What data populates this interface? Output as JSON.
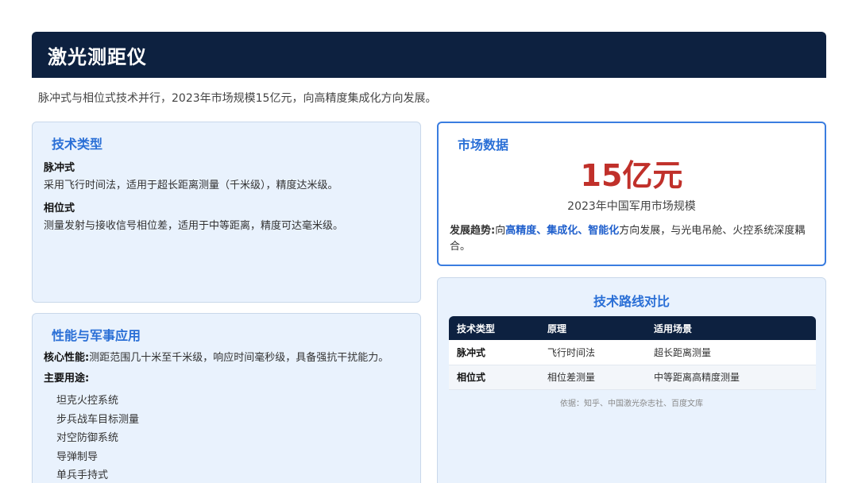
{
  "header": {
    "title": "激光测距仪"
  },
  "subtitle": "脉冲式与相位式技术并行，2023年市场规模15亿元，向高精度集成化方向发展。",
  "tech_types": {
    "title": "技术类型",
    "items": [
      {
        "name": "脉冲式",
        "desc": "采用飞行时间法，适用于超长距离测量（千米级），精度达米级。"
      },
      {
        "name": "相位式",
        "desc": "测量发射与接收信号相位差，适用于中等距离，精度可达毫米级。"
      }
    ]
  },
  "performance": {
    "title": "性能与军事应用",
    "core_label": "核心性能:",
    "core_text": "测距范围几十米至千米级，响应时间毫秒级，具备强抗干扰能力。",
    "uses_label": "主要用途:",
    "uses": [
      "坦克火控系统",
      "步兵战车目标测量",
      "对空防御系统",
      "导弹制导",
      "单兵手持式"
    ]
  },
  "market": {
    "title": "市场数据",
    "value": "15亿元",
    "caption": "2023年中国军用市场规模",
    "trend_label": "发展趋势:",
    "trend_pre": "向",
    "trend_hl1": "高精度",
    "sep1": "、",
    "trend_hl2": "集成化",
    "sep2": "、",
    "trend_hl3": "智能化",
    "trend_post": "方向发展，与光电吊舱、火控系统深度耦合。"
  },
  "routes": {
    "title": "技术路线对比",
    "headers": [
      "技术类型",
      "原理",
      "适用场景"
    ],
    "rows": [
      [
        "脉冲式",
        "飞行时间法",
        "超长距离测量"
      ],
      [
        "相位式",
        "相位差测量",
        "中等距离高精度测量"
      ]
    ],
    "source": "依据：知乎、中国激光杂志社、百度文库"
  },
  "colors": {
    "header_bg": "#0d2140",
    "accent": "#2a6fd6",
    "highlight_red": "#c0302a"
  }
}
